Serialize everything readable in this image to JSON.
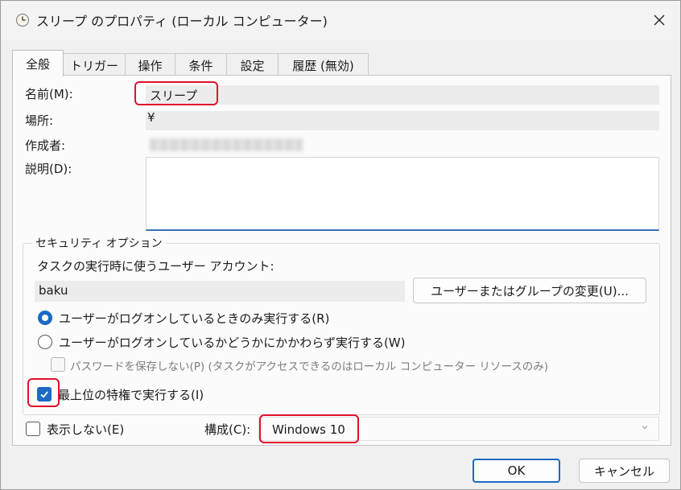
{
  "window": {
    "title": "スリープ のプロパティ (ローカル コンピューター)"
  },
  "tabs": [
    {
      "label": "全般"
    },
    {
      "label": "トリガー"
    },
    {
      "label": "操作"
    },
    {
      "label": "条件"
    },
    {
      "label": "設定"
    },
    {
      "label": "履歴 (無効)"
    }
  ],
  "general": {
    "name_label": "名前(M):",
    "name_value": "スリープ",
    "location_label": "場所:",
    "location_value": "¥",
    "author_label": "作成者:",
    "description_label": "説明(D):",
    "description_value": ""
  },
  "security": {
    "group_title": "セキュリティ オプション",
    "account_label": "タスクの実行時に使うユーザー アカウント:",
    "account_value": "baku",
    "change_user_button": "ユーザーまたはグループの変更(U)...",
    "radio_logged_on": "ユーザーがログオンしているときのみ実行する(R)",
    "radio_whether": "ユーザーがログオンしているかどうかにかかわらず実行する(W)",
    "no_store_password": "パスワードを保存しない(P) (タスクがアクセスできるのはローカル コンピューター リソースのみ)",
    "highest_privileges": "最上位の特権で実行する(I)"
  },
  "bottom": {
    "hidden_label": "表示しない(E)",
    "configure_label": "構成(C):",
    "configure_value": "Windows 10"
  },
  "buttons": {
    "ok": "OK",
    "cancel": "キャンセル"
  },
  "colors": {
    "accent": "#1c6ac4",
    "highlight": "#e0112b"
  }
}
